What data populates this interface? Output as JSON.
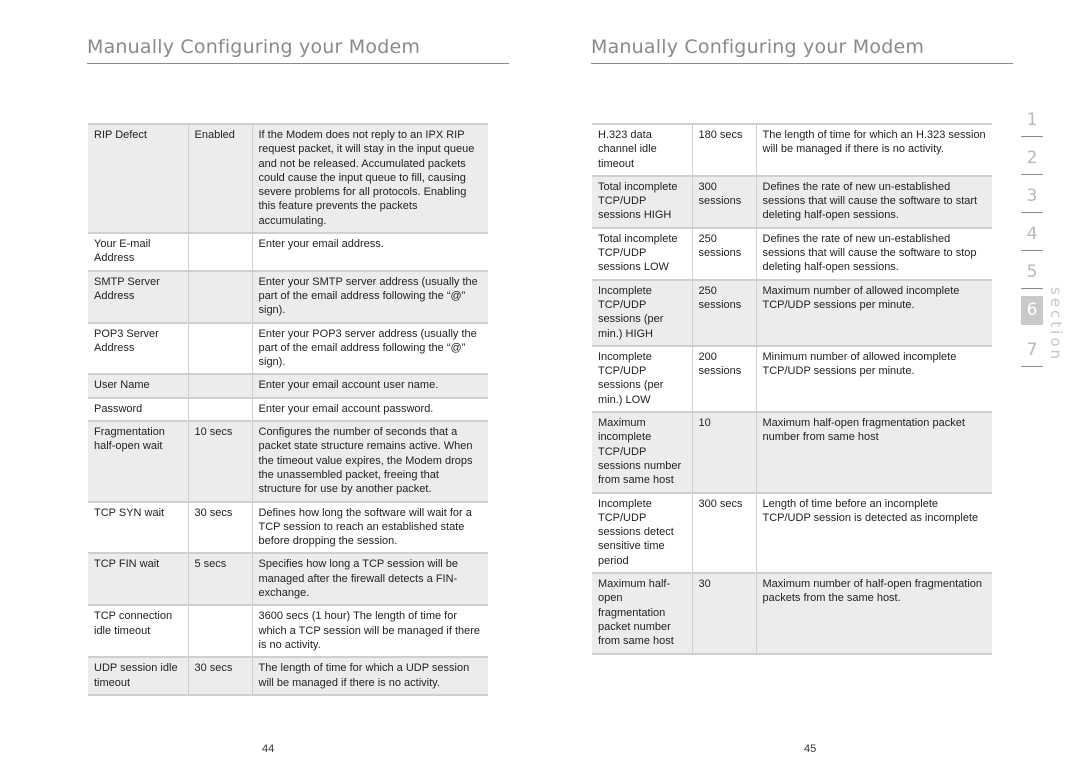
{
  "left_page": {
    "title": "Manually Configuring your Modem",
    "page_number": "44",
    "rows": [
      {
        "setting": "RIP Defect",
        "value": "Enabled",
        "description": "If the Modem does not reply to an IPX RIP request packet, it will stay in the input queue and not be released. Accumulated packets could cause the input queue to fill, causing severe problems for all protocols. Enabling this feature prevents the packets accumulating."
      },
      {
        "setting": "Your E-mail Address",
        "value": "",
        "description": "Enter your email address."
      },
      {
        "setting": "SMTP Server Address",
        "value": "",
        "description": "Enter your SMTP server address (usually the part of the email address following the “@” sign)."
      },
      {
        "setting": "POP3 Server Address",
        "value": "",
        "description": "Enter your POP3 server address (usually the part of the email address following the “@” sign)."
      },
      {
        "setting": "User Name",
        "value": "",
        "description": "Enter your email account user name."
      },
      {
        "setting": "Password",
        "value": "",
        "description": "Enter your email account password."
      },
      {
        "setting": "Fragmentation half-open wait",
        "value": "10 secs",
        "description": "Configures the number of seconds that a packet state structure remains active. When the timeout value expires, the Modem drops the unassembled packet, freeing that structure for use by another packet."
      },
      {
        "setting": "TCP SYN wait",
        "value": "30 secs",
        "description": "Defines how long the software will wait for a TCP session to reach an established state before dropping the session."
      },
      {
        "setting": "TCP FIN wait",
        "value": "5 secs",
        "description": "Specifies how long a TCP session will be managed after the firewall detects a FIN-exchange."
      },
      {
        "setting": "TCP connection idle timeout",
        "value": "",
        "description": "3600 secs (1 hour) The length of time for which a TCP session will be managed if there is no activity."
      },
      {
        "setting": "UDP session idle timeout",
        "value": "30 secs",
        "description": "The length of time for which a UDP session will be managed if there is no activity."
      }
    ]
  },
  "right_page": {
    "title": "Manually Configuring your Modem",
    "page_number": "45",
    "rows": [
      {
        "setting": "H.323 data channel idle timeout",
        "value": "180 secs",
        "description": "The length of time for which an H.323 session will be managed if there is no activity."
      },
      {
        "setting": "Total incomplete TCP/UDP sessions HIGH",
        "value": "300 sessions",
        "description": "Defines the rate of new un-established sessions that will cause the software to start deleting half-open sessions."
      },
      {
        "setting": "Total incomplete TCP/UDP sessions LOW",
        "value": "250 sessions",
        "description": "Defines the rate of new un-established sessions that will cause the software to stop deleting half-open sessions."
      },
      {
        "setting": "Incomplete TCP/UDP sessions (per min.) HIGH",
        "value": "250 sessions",
        "description": "Maximum number of allowed incomplete TCP/UDP sessions per minute."
      },
      {
        "setting": "Incomplete TCP/UDP sessions (per min.) LOW",
        "value": "200 sessions",
        "description": "Minimum number of allowed incomplete TCP/UDP sessions per minute."
      },
      {
        "setting": "Maximum incomplete TCP/UDP sessions number from same host",
        "value": "10",
        "description": "Maximum half-open fragmentation packet number from same host"
      },
      {
        "setting": "Incomplete TCP/UDP sessions detect sensitive time period",
        "value": "300 secs",
        "description": "Length of time before an incomplete TCP/UDP session is detected as incomplete"
      },
      {
        "setting": "Maximum half-open fragmentation packet number from same host",
        "value": "30",
        "description": "Maximum number of half-open fragmentation packets from the same host."
      }
    ]
  },
  "section_nav": {
    "label": "section",
    "active": "6",
    "items": [
      "1",
      "2",
      "3",
      "4",
      "5",
      "6",
      "7"
    ]
  },
  "colors": {
    "title_gray": "#8a8a8a",
    "row_shade": "#ececec",
    "active_section": "#c9c9c9"
  }
}
